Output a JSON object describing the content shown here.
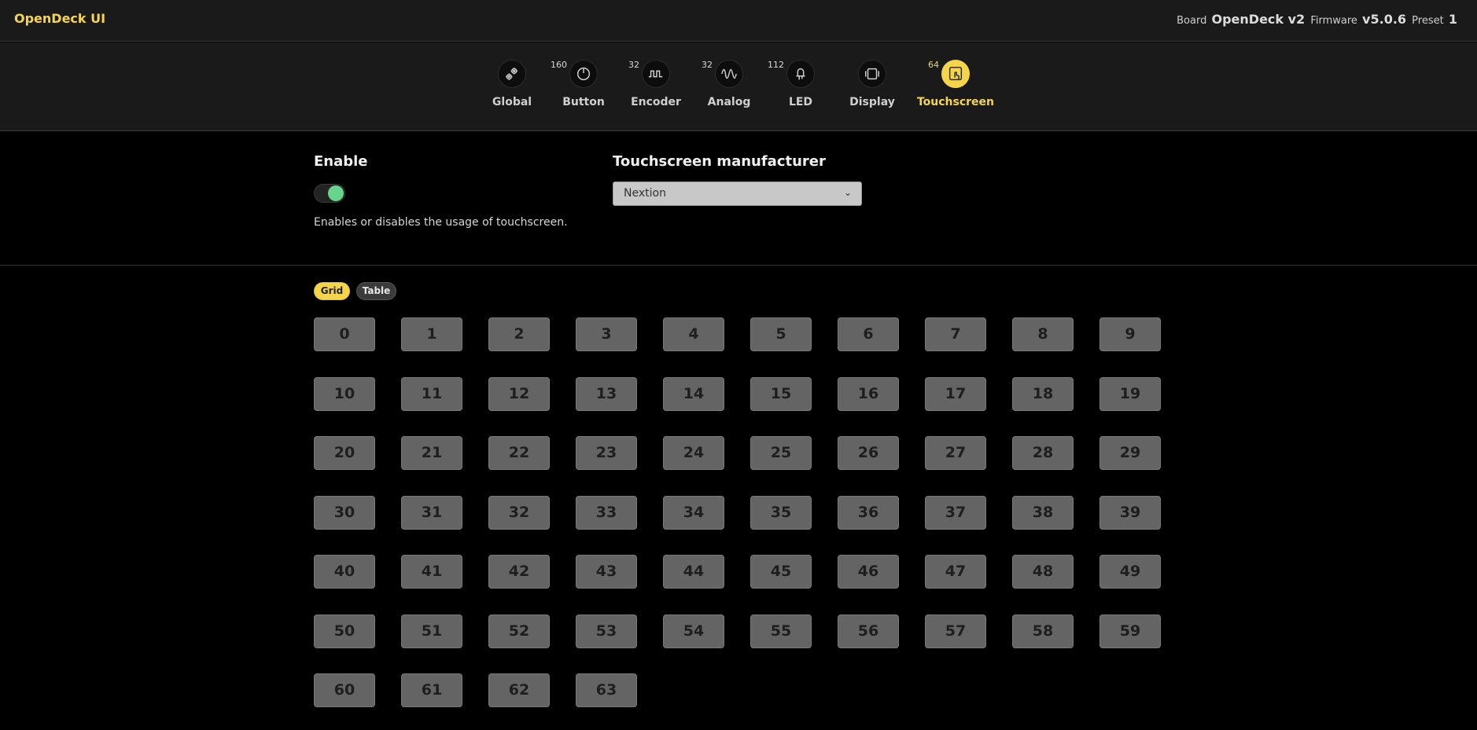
{
  "app": {
    "title": "OpenDeck UI"
  },
  "device": {
    "board_label": "Board",
    "board": "OpenDeck v2",
    "firmware_label": "Firmware",
    "firmware": "v5.0.6",
    "preset_label": "Preset",
    "preset": "1"
  },
  "nav": [
    {
      "label": "Global",
      "count": "",
      "icon": "gears-icon",
      "active": false
    },
    {
      "label": "Button",
      "count": "160",
      "icon": "power-knob-icon",
      "active": false
    },
    {
      "label": "Encoder",
      "count": "32",
      "icon": "square-wave-icon",
      "active": false
    },
    {
      "label": "Analog",
      "count": "32",
      "icon": "sine-wave-icon",
      "active": false
    },
    {
      "label": "LED",
      "count": "112",
      "icon": "led-icon",
      "active": false
    },
    {
      "label": "Display",
      "count": "",
      "icon": "display-icon",
      "active": false
    },
    {
      "label": "Touchscreen",
      "count": "64",
      "icon": "touch-hand-icon",
      "active": true
    }
  ],
  "settings": {
    "enable": {
      "title": "Enable",
      "on": true,
      "description": "Enables or disables the usage of touchscreen."
    },
    "manufacturer": {
      "title": "Touchscreen manufacturer",
      "value": "Nextion"
    }
  },
  "view": {
    "grid_label": "Grid",
    "table_label": "Table",
    "selected": "Grid"
  },
  "components": [
    "0",
    "1",
    "2",
    "3",
    "4",
    "5",
    "6",
    "7",
    "8",
    "9",
    "10",
    "11",
    "12",
    "13",
    "14",
    "15",
    "16",
    "17",
    "18",
    "19",
    "20",
    "21",
    "22",
    "23",
    "24",
    "25",
    "26",
    "27",
    "28",
    "29",
    "30",
    "31",
    "32",
    "33",
    "34",
    "35",
    "36",
    "37",
    "38",
    "39",
    "40",
    "41",
    "42",
    "43",
    "44",
    "45",
    "46",
    "47",
    "48",
    "49",
    "50",
    "51",
    "52",
    "53",
    "54",
    "55",
    "56",
    "57",
    "58",
    "59",
    "60",
    "61",
    "62",
    "63"
  ],
  "colors": {
    "accent": "#f5d54a",
    "toggle_on": "#66d48b",
    "cell_bg": "#646464"
  }
}
